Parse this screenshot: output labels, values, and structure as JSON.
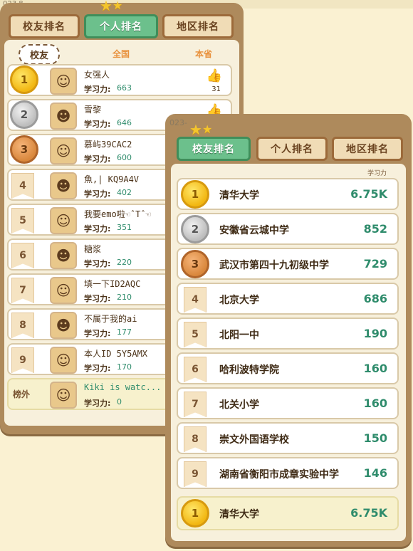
{
  "top_cut_text": "023 8",
  "left_panel": {
    "tabs": [
      {
        "label": "校友排名",
        "active": false
      },
      {
        "label": "个人排名",
        "active": true
      },
      {
        "label": "地区排名",
        "active": false
      }
    ],
    "subtabs": {
      "active": "校友",
      "middle": "全国",
      "right": "本省"
    },
    "stat_label": "学习力:",
    "rows": [
      {
        "rank": "1",
        "name": "女强人",
        "value": "663",
        "likes": "31"
      },
      {
        "rank": "2",
        "name": "雪黎",
        "value": "646"
      },
      {
        "rank": "3",
        "name": "慕屿39CAC2",
        "value": "600"
      },
      {
        "rank": "4",
        "name": "魚,| KQ9A4V",
        "value": "402"
      },
      {
        "rank": "5",
        "name": "我要emo啦☜ˆTˆ☜",
        "value": "351"
      },
      {
        "rank": "6",
        "name": "糖浆",
        "value": "220"
      },
      {
        "rank": "7",
        "name": "填一下ID2AQC",
        "value": "210"
      },
      {
        "rank": "8",
        "name": "不属于我的ai",
        "value": "177"
      },
      {
        "rank": "9",
        "name": "本人ID 5Y5AMX",
        "value": "170"
      }
    ],
    "self_row": {
      "rank": "榜外",
      "name": "Kiki is watc...",
      "value": "0"
    }
  },
  "right_panel": {
    "date_cut": "023-",
    "tabs": [
      {
        "label": "校友排名",
        "active": true
      },
      {
        "label": "个人排名",
        "active": false
      },
      {
        "label": "地区排名",
        "active": false
      }
    ],
    "column_header": "学习力",
    "rows": [
      {
        "rank": "1",
        "name": "清华大学",
        "value": "6.75K"
      },
      {
        "rank": "2",
        "name": "安徽省云城中学",
        "value": "852"
      },
      {
        "rank": "3",
        "name": "武汉市第四十九初级中学",
        "value": "729"
      },
      {
        "rank": "4",
        "name": "北京大学",
        "value": "686"
      },
      {
        "rank": "5",
        "name": "北阳一中",
        "value": "190"
      },
      {
        "rank": "6",
        "name": "哈利波特学院",
        "value": "160"
      },
      {
        "rank": "7",
        "name": "北关小学",
        "value": "160"
      },
      {
        "rank": "8",
        "name": "崇文外国语学校",
        "value": "150"
      },
      {
        "rank": "9",
        "name": "湖南省衡阳市成章实验中学",
        "value": "146"
      }
    ],
    "self_row": {
      "rank": "1",
      "name": "清华大学",
      "value": "6.75K"
    }
  },
  "icons": {
    "like": "thumbs-up-icon",
    "star": "star-icon"
  }
}
